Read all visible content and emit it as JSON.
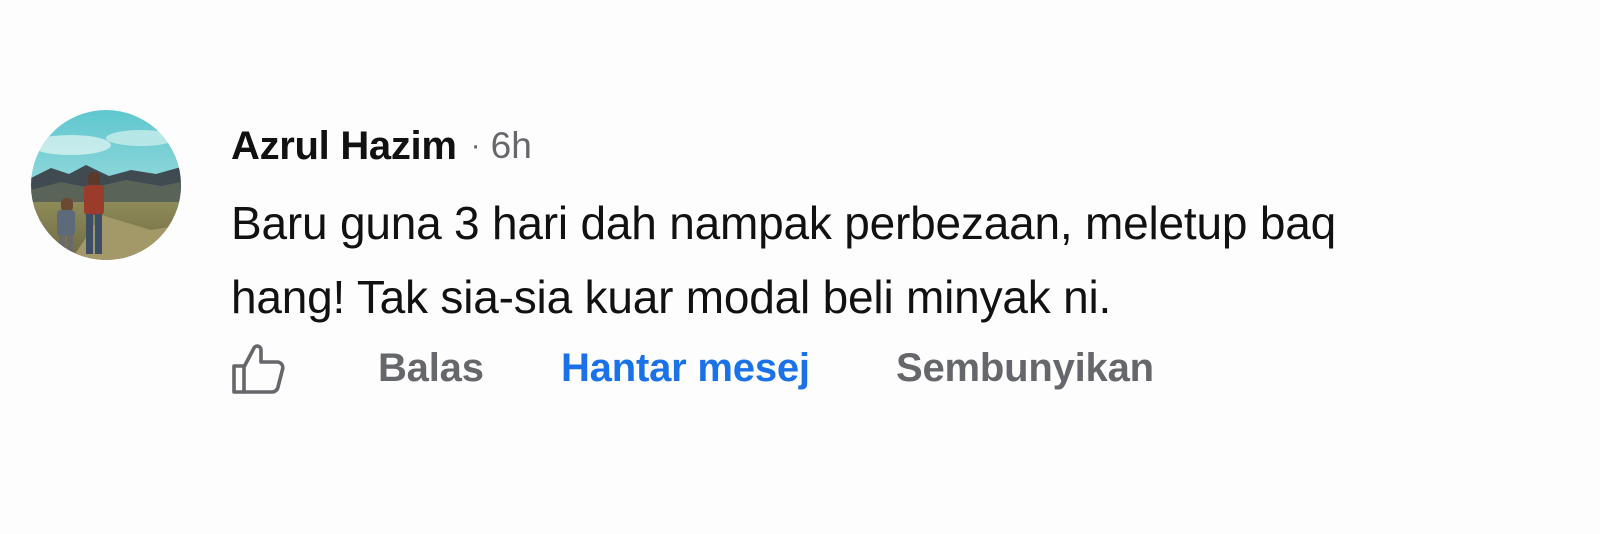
{
  "comment": {
    "author": "Azrul Hazim",
    "separator": "·",
    "time": "6h",
    "line1": "Baru guna 3 hari dah nampak perbezaan, meletup baq",
    "line2": "hang! Tak sia-sia kuar modal beli minyak ni.",
    "avatar": "profile-photo"
  },
  "actions": {
    "like_icon": "thumbs-up-icon",
    "reply_label": "Balas",
    "message_label": "Hantar mesej",
    "hide_label": "Sembunyikan"
  },
  "colors": {
    "text": "#111111",
    "secondary": "#65676b",
    "link": "#1b72e8",
    "background": "#fdfdfd"
  }
}
